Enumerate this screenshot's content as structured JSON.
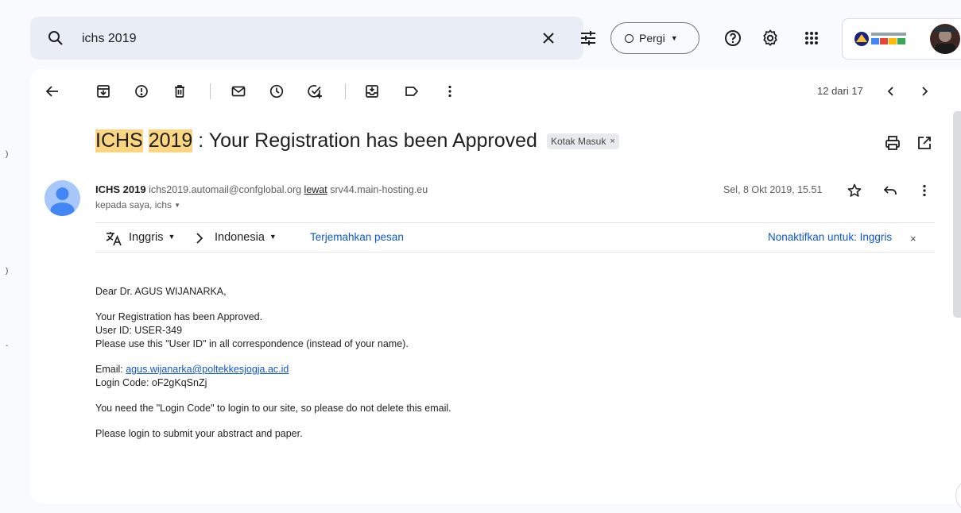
{
  "search": {
    "query": "ichs 2019"
  },
  "status": {
    "label": "Pergi"
  },
  "icons": {
    "search": "search-icon",
    "clear": "close-icon",
    "filters": "tune-icon",
    "help": "help-icon",
    "settings": "gear-icon",
    "apps": "apps-grid-icon",
    "back": "arrow-back-icon",
    "archive": "archive-icon",
    "spam": "report-spam-icon",
    "delete": "trash-icon",
    "unread": "mail-icon",
    "snooze": "clock-icon",
    "task": "add-task-icon",
    "move": "move-to-inbox-icon",
    "label": "label-icon",
    "more": "more-vert-icon",
    "print": "print-icon",
    "open-new": "open-in-new-icon",
    "star": "star-icon",
    "reply": "reply-icon",
    "translate": "translate-icon"
  },
  "pagination": {
    "label": "12 dari 17"
  },
  "email": {
    "subject_hl1": "ICHS",
    "subject_hl2": "2019",
    "subject_rest": ": Your Registration has been Approved",
    "label": "Kotak Masuk",
    "label_remove": "×",
    "sender_name": "ICHS 2019",
    "sender_email": "ichs2019.automail@confglobal.org",
    "via_word": "lewat",
    "via_host": "srv44.main-hosting.eu",
    "recipients": "kepada saya, ichs",
    "date": "Sel, 8 Okt 2019, 15.51"
  },
  "translate": {
    "from": "Inggris",
    "to": "Indonesia",
    "action": "Terjemahkan pesan",
    "disable": "Nonaktifkan untuk: Inggris",
    "disable_close": "×"
  },
  "body": {
    "greeting": "Dear Dr. AGUS WIJANARKA,",
    "line1": "Your Registration has been Approved.",
    "line2": "User ID: USER-349",
    "line3": "Please use this \"User ID\" in all correspondence (instead of your name).",
    "email_label": "Email:",
    "email_value": "agus.wijanarka@poltekkesjogja.ac.id",
    "login_code": "Login Code: oF2gKqSnZj",
    "line4": "You need the \"Login Code\" to login to our site, so please do not delete this email.",
    "line5": "Please login to submit your abstract and paper."
  },
  "colors": {
    "accent": "#0b57d0",
    "highlight": "#fcd581",
    "background": "#f8fafd",
    "search_bg": "#e9eef6"
  }
}
